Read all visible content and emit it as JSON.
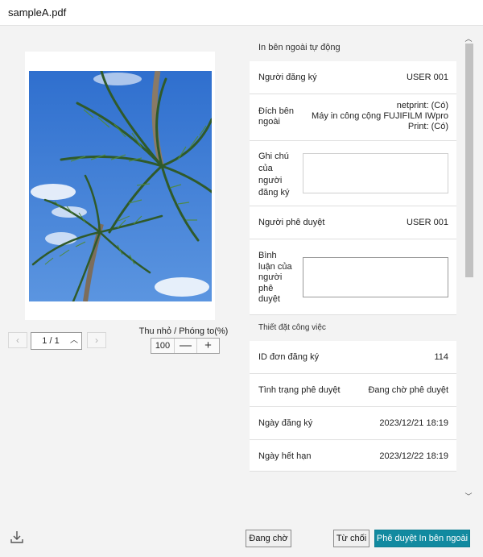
{
  "window": {
    "title": "sampleA.pdf"
  },
  "preview": {
    "pager": {
      "current": "1 / 1",
      "prev_icon": "chevron-left-icon",
      "next_icon": "chevron-right-icon",
      "toggle_icon": "chevron-up-icon"
    },
    "zoom": {
      "label": "Thu nhỏ / Phóng to(%)",
      "value": "100",
      "minus": "—",
      "plus": "+"
    }
  },
  "form": {
    "external_section": {
      "title": "In bên ngoài tự động",
      "requester": {
        "label": "Người đăng ký",
        "value": "USER 001"
      },
      "destination": {
        "label_lines": [
          "Đích bên",
          "ngoài"
        ],
        "value_lines": [
          "netprint: (Có)",
          "Máy in công cộng FUJIFILM IWpro",
          "Print: (Có)"
        ]
      },
      "requester_note": {
        "label_lines": [
          "Ghi chú",
          "của",
          "người",
          "đăng ký"
        ],
        "value": ""
      },
      "approver": {
        "label": "Người phê duyệt",
        "value": "USER 001"
      },
      "approver_comment": {
        "label_lines": [
          "Bình",
          "luận của",
          "người",
          "phê",
          "duyệt"
        ],
        "value": ""
      }
    },
    "job_section": {
      "title": "Thiết đặt công việc",
      "request_id": {
        "label": "ID đơn đăng ký",
        "value": "114"
      },
      "approval_status": {
        "label": "Tình trạng phê duyệt",
        "value": "Đang chờ phê duyệt"
      },
      "request_date": {
        "label": "Ngày đăng ký",
        "value": "2023/12/21 18:19"
      },
      "expiry_date": {
        "label": "Ngày hết hạn",
        "value": "2023/12/22 18:19"
      }
    }
  },
  "footer": {
    "download_icon": "download-icon",
    "pending_label": "Đang chờ",
    "reject_label": "Từ chối",
    "approve_label": "Phê duyệt In bên ngoài"
  },
  "colors": {
    "primary": "#128aa0",
    "background": "#f3f3f3",
    "sky": "#3a78d4"
  }
}
